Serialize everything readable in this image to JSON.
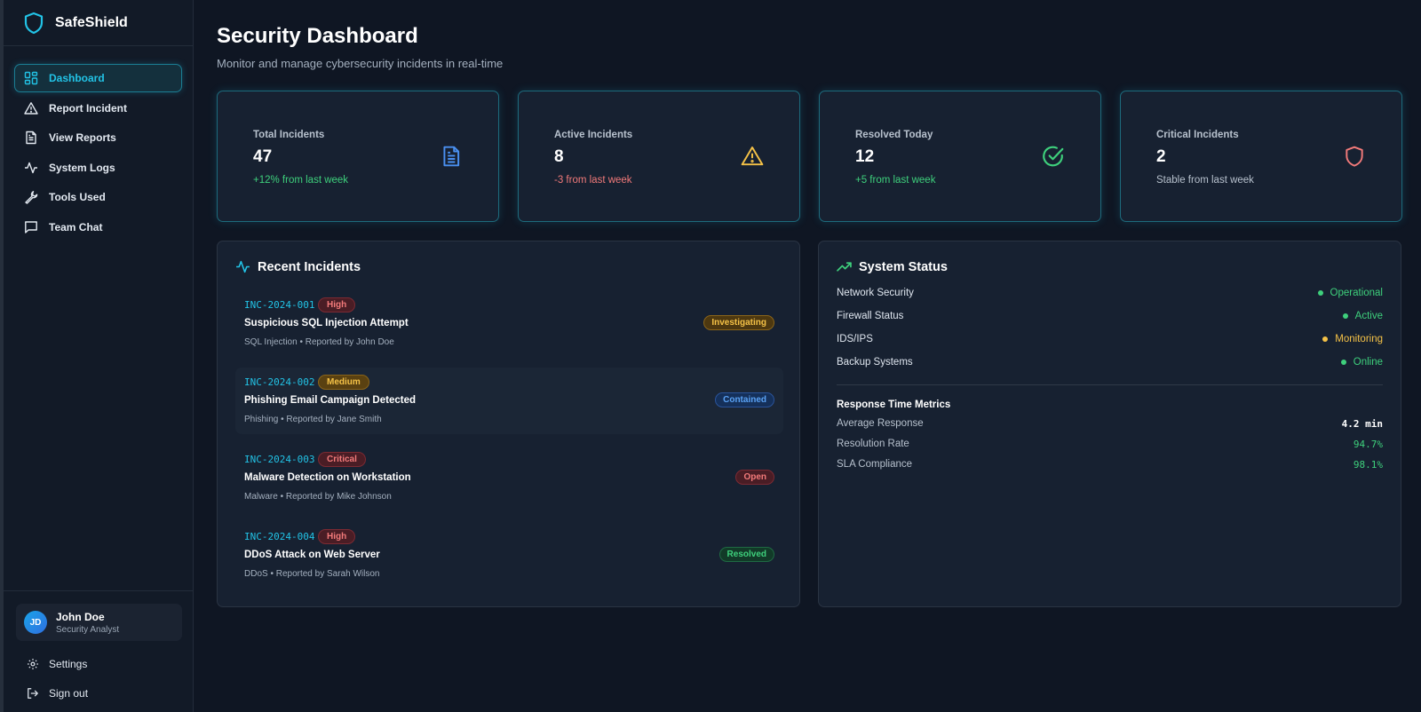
{
  "app": {
    "name": "SafeShield"
  },
  "colors": {
    "accent": "#22c3e6",
    "success": "#3ed07c",
    "danger": "#f27a7a",
    "warning": "#f5c247",
    "info": "#5aa2f5"
  },
  "sidebar": {
    "items": [
      {
        "label": "Dashboard",
        "icon": "dashboard-grid-icon",
        "active": true
      },
      {
        "label": "Report Incident",
        "icon": "alert-triangle-icon"
      },
      {
        "label": "View Reports",
        "icon": "file-text-icon"
      },
      {
        "label": "System Logs",
        "icon": "activity-icon"
      },
      {
        "label": "Tools Used",
        "icon": "wrench-icon"
      },
      {
        "label": "Team Chat",
        "icon": "message-square-icon"
      }
    ],
    "user": {
      "initials": "JD",
      "name": "John Doe",
      "role": "Security Analyst"
    },
    "settings_label": "Settings",
    "signout_label": "Sign out"
  },
  "header": {
    "title": "Security Dashboard",
    "subtitle": "Monitor and manage cybersecurity incidents in real-time"
  },
  "stats": [
    {
      "label": "Total Incidents",
      "value": "47",
      "delta": "+12% from last week",
      "delta_color": "#3ed07c",
      "icon": "file-text-icon",
      "icon_color": "#4a90f0"
    },
    {
      "label": "Active Incidents",
      "value": "8",
      "delta": "-3 from last week",
      "delta_color": "#f27a7a",
      "icon": "alert-triangle-icon",
      "icon_color": "#f5c247"
    },
    {
      "label": "Resolved Today",
      "value": "12",
      "delta": "+5 from last week",
      "delta_color": "#3ed07c",
      "icon": "check-circle-icon",
      "icon_color": "#3ed07c"
    },
    {
      "label": "Critical Incidents",
      "value": "2",
      "delta": "Stable from last week",
      "delta_color": "#b7c1cd",
      "icon": "shield-icon",
      "icon_color": "#f27a7a"
    }
  ],
  "recent": {
    "title": "Recent Incidents",
    "items": [
      {
        "id": "INC-2024-001",
        "severity": "High",
        "title": "Suspicious SQL Injection Attempt",
        "meta": "SQL Injection • Reported by John Doe",
        "status": "Investigating"
      },
      {
        "id": "INC-2024-002",
        "severity": "Medium",
        "title": "Phishing Email Campaign Detected",
        "meta": "Phishing • Reported by Jane Smith",
        "status": "Contained"
      },
      {
        "id": "INC-2024-003",
        "severity": "Critical",
        "title": "Malware Detection on Workstation",
        "meta": "Malware • Reported by Mike Johnson",
        "status": "Open"
      },
      {
        "id": "INC-2024-004",
        "severity": "High",
        "title": "DDoS Attack on Web Server",
        "meta": "DDoS • Reported by Sarah Wilson",
        "status": "Resolved"
      }
    ]
  },
  "system": {
    "title": "System Status",
    "rows": [
      {
        "name": "Network Security",
        "state": "Operational",
        "color": "#3ed07c"
      },
      {
        "name": "Firewall Status",
        "state": "Active",
        "color": "#3ed07c"
      },
      {
        "name": "IDS/IPS",
        "state": "Monitoring",
        "color": "#f5c247"
      },
      {
        "name": "Backup Systems",
        "state": "Online",
        "color": "#3ed07c"
      }
    ],
    "metrics_title": "Response Time Metrics",
    "metrics": [
      {
        "name": "Average Response",
        "value": "4.2 min",
        "color": "#ffffff"
      },
      {
        "name": "Resolution Rate",
        "value": "94.7%",
        "color": "#3ed07c"
      },
      {
        "name": "SLA Compliance",
        "value": "98.1%",
        "color": "#3ed07c"
      }
    ]
  }
}
